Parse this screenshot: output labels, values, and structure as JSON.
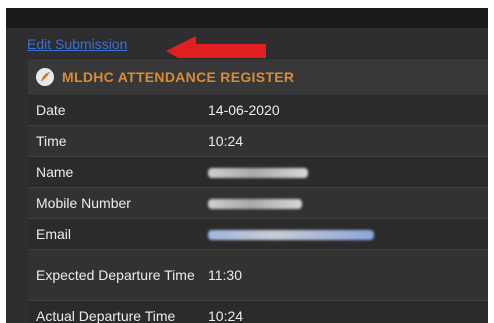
{
  "edit_link": "Edit Submission",
  "form": {
    "title": "MLDHC ATTENDANCE REGISTER",
    "logo_icon": "feather-logo-icon"
  },
  "rows": [
    {
      "label": "Date",
      "value": "14-06-2020"
    },
    {
      "label": "Time",
      "value": "10:24"
    },
    {
      "label": "Name",
      "value": ""
    },
    {
      "label": "Mobile Number",
      "value": ""
    },
    {
      "label": "Email",
      "value": ""
    },
    {
      "label": "Expected Departure Time",
      "value": "11:30"
    },
    {
      "label": "Actual Departure Time",
      "value": "10:24"
    }
  ],
  "colors": {
    "accent_orange": "#d98b35",
    "link_blue": "#3b6fd0",
    "arrow_red": "#e02020"
  }
}
